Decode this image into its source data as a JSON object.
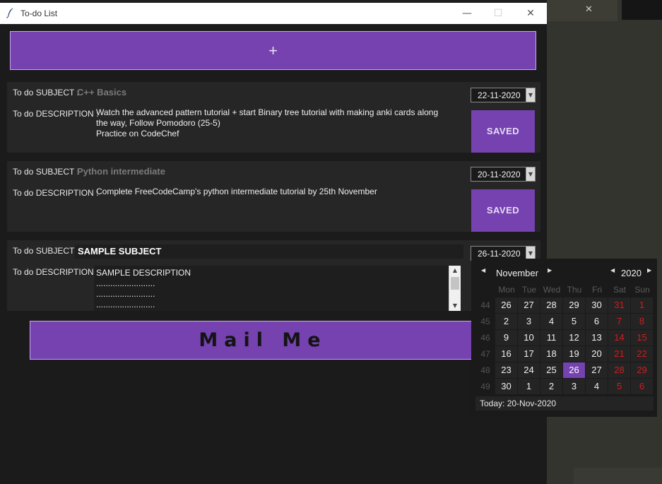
{
  "window": {
    "title": "To-do List",
    "minimize_glyph": "—",
    "maximize_glyph": "☐",
    "close_glyph": "✕"
  },
  "background": {
    "tab_close_glyph": "✕"
  },
  "add_button": {
    "label": "+"
  },
  "labels": {
    "subject": "To do SUBJECT :",
    "description": "To do DESCRIPTION :"
  },
  "tasks": [
    {
      "subject": "C++ Basics",
      "description_lines": [
        "Watch the advanced pattern tutorial + start Binary tree tutorial with making anki cards along",
        "the way, Follow Pomodoro (25-5)",
        "Practice on CodeChef"
      ],
      "date": "22-11-2020",
      "button": "SAVED"
    },
    {
      "subject": "Python intermediate",
      "description_lines": [
        "Complete FreeCodeCamp's python intermediate tutorial by 25th November"
      ],
      "date": "20-11-2020",
      "button": "SAVED"
    },
    {
      "subject": "SAMPLE SUBJECT",
      "description": "SAMPLE DESCRIPTION\n.........................\n.........................\n.........................",
      "date": "26-11-2020"
    }
  ],
  "mail_button": {
    "label": "Mail Me"
  },
  "calendar": {
    "month": "November",
    "year": "2020",
    "weekdays": [
      "Mon",
      "Tue",
      "Wed",
      "Thu",
      "Fri",
      "Sat",
      "Sun"
    ],
    "weeks": [
      {
        "num": "44",
        "days": [
          "26",
          "27",
          "28",
          "29",
          "30",
          "31",
          "1"
        ]
      },
      {
        "num": "45",
        "days": [
          "2",
          "3",
          "4",
          "5",
          "6",
          "7",
          "8"
        ]
      },
      {
        "num": "46",
        "days": [
          "9",
          "10",
          "11",
          "12",
          "13",
          "14",
          "15"
        ]
      },
      {
        "num": "47",
        "days": [
          "16",
          "17",
          "18",
          "19",
          "20",
          "21",
          "22"
        ]
      },
      {
        "num": "48",
        "days": [
          "23",
          "24",
          "25",
          "26",
          "27",
          "28",
          "29"
        ]
      },
      {
        "num": "49",
        "days": [
          "30",
          "1",
          "2",
          "3",
          "4",
          "5",
          "6"
        ]
      }
    ],
    "selected_day": "26",
    "today_label": "Today: 20-Nov-2020",
    "colors": {
      "selected": "#7542b0",
      "weekend": "#d11c1c"
    }
  },
  "colors": {
    "accent": "#7542b0",
    "window_bg": "#1b1b1b",
    "card_bg": "#262626"
  }
}
